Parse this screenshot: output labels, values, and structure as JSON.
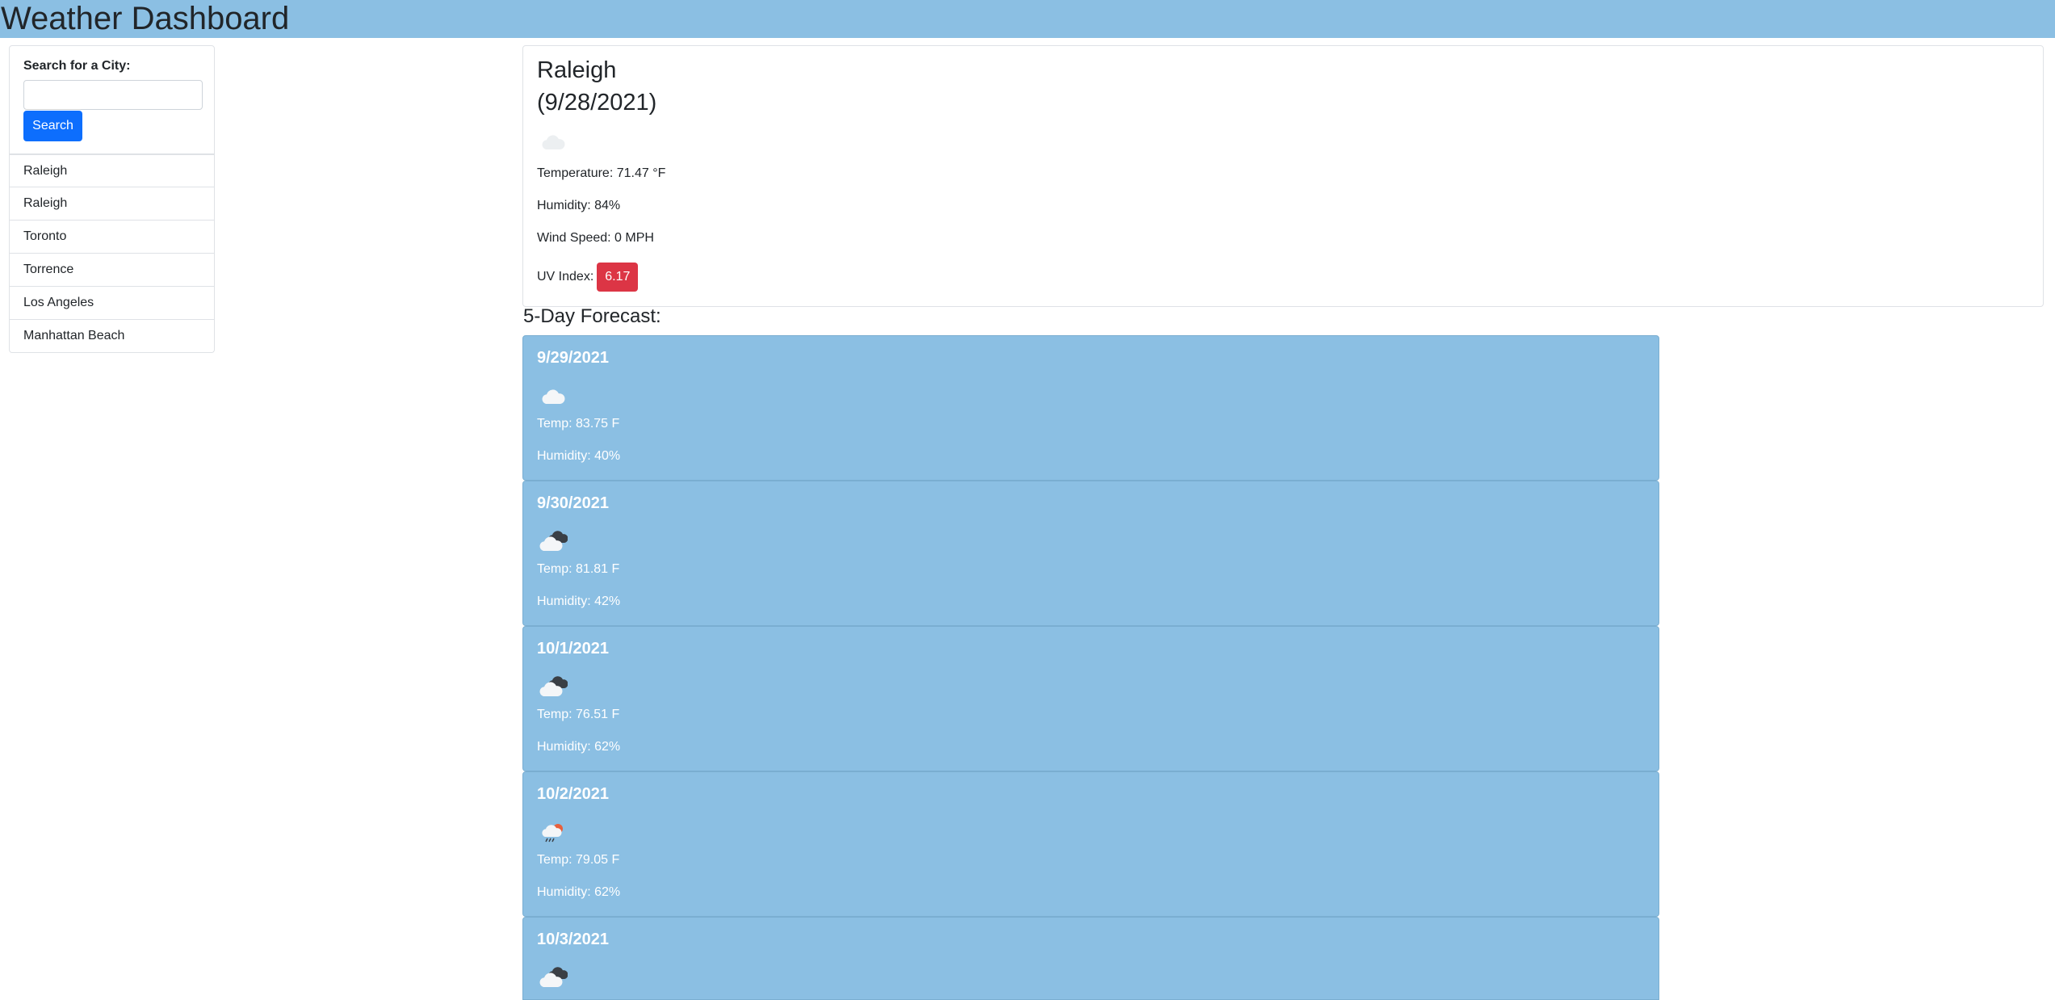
{
  "header": {
    "title": "Weather Dashboard"
  },
  "search": {
    "label": "Search for a City:",
    "input_value": "",
    "placeholder": "",
    "button_label": "Search"
  },
  "history": [
    "Raleigh",
    "Raleigh",
    "Toronto",
    "Torrence",
    "Los Angeles",
    "Manhattan Beach"
  ],
  "current": {
    "city": "Raleigh",
    "date": "(9/28/2021)",
    "icon": "cloud-icon",
    "temperature": "Temperature: 71.47 °F",
    "humidity": "Humidity: 84%",
    "wind": "Wind Speed: 0 MPH",
    "uv_label": "UV Index:",
    "uv_value": "6.17",
    "uv_color": "#dc3545"
  },
  "forecast": {
    "title": "5-Day Forecast:",
    "days": [
      {
        "date": "9/29/2021",
        "icon": "cloud-icon",
        "temp": "Temp: 83.75 F",
        "humidity": "Humidity: 40%"
      },
      {
        "date": "9/30/2021",
        "icon": "broken-clouds-icon",
        "temp": "Temp: 81.81 F",
        "humidity": "Humidity: 42%"
      },
      {
        "date": "10/1/2021",
        "icon": "broken-clouds-icon",
        "temp": "Temp: 76.51 F",
        "humidity": "Humidity: 62%"
      },
      {
        "date": "10/2/2021",
        "icon": "rain-sun-icon",
        "temp": "Temp: 79.05 F",
        "humidity": "Humidity: 62%"
      },
      {
        "date": "10/3/2021",
        "icon": "broken-clouds-icon",
        "temp": "",
        "humidity": ""
      }
    ]
  },
  "colors": {
    "header_bg": "#8bbfe3",
    "card_bg": "#8bbfe3",
    "button": "#0d6efd",
    "uv_badge": "#dc3545"
  }
}
